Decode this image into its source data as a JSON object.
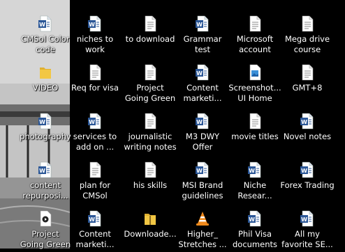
{
  "desktop": {
    "left_column": [
      {
        "label": "CMSol Color\ncode",
        "icon": "word-doc-icon"
      },
      {
        "label": "VIDEO",
        "icon": "folder-icon"
      },
      {
        "label": "photography",
        "icon": "word-doc-icon"
      },
      {
        "label": "content\nrepurposi...",
        "icon": "word-doc-icon"
      },
      {
        "label": "Project\nGoing Green",
        "icon": "video-file-icon"
      }
    ],
    "columns": [
      [
        {
          "label": "niches to\nwork",
          "icon": "word-doc-icon"
        },
        {
          "label": "Req for visa",
          "icon": "text-file-icon"
        },
        {
          "label": "services to\nadd on ...",
          "icon": "word-doc-icon"
        },
        {
          "label": "plan for\nCMSol",
          "icon": "text-file-icon"
        },
        {
          "label": "Content\nmarketi...",
          "icon": "word-doc-icon"
        }
      ],
      [
        {
          "label": "to download",
          "icon": "text-file-icon"
        },
        {
          "label": "Project\nGoing Green",
          "icon": "text-file-icon"
        },
        {
          "label": "journalistic\nwriting notes",
          "icon": "text-file-icon"
        },
        {
          "label": "his skills",
          "icon": "text-file-icon"
        },
        {
          "label": "Downloade...",
          "icon": "zip-folder-icon"
        }
      ],
      [
        {
          "label": "Grammar\ntest",
          "icon": "word-doc-icon"
        },
        {
          "label": "Content\nmarketi...",
          "icon": "word-doc-icon"
        },
        {
          "label": "M3 DWY\nOffer",
          "icon": "word-doc-icon"
        },
        {
          "label": "MSI Brand\nguidelines",
          "icon": "word-doc-icon"
        },
        {
          "label": "Higher_\nStretches ...",
          "icon": "vlc-cone-icon"
        }
      ],
      [
        {
          "label": "Microsoft\naccount",
          "icon": "text-file-icon"
        },
        {
          "label": "Screenshot...\nUI Home",
          "icon": "image-file-icon"
        },
        {
          "label": "movie titles",
          "icon": "text-file-icon"
        },
        {
          "label": "Niche\nResear...",
          "icon": "word-doc-icon"
        },
        {
          "label": "Phil Visa\ndocuments",
          "icon": "word-doc-icon"
        }
      ],
      [
        {
          "label": "Mega drive\ncourse",
          "icon": "text-file-icon"
        },
        {
          "label": "GMT+8",
          "icon": "text-file-icon"
        },
        {
          "label": "Novel notes",
          "icon": "word-doc-icon"
        },
        {
          "label": "Forex Trading",
          "icon": "word-doc-icon"
        },
        {
          "label": "All my\nfavorite SE...",
          "icon": "word-doc-icon"
        }
      ]
    ]
  },
  "colors": {
    "word_blue": "#2b5797",
    "folder_yellow": "#f2c744",
    "vlc_orange": "#f08a1c",
    "label_text": "#ffffff",
    "background": "#000000"
  }
}
